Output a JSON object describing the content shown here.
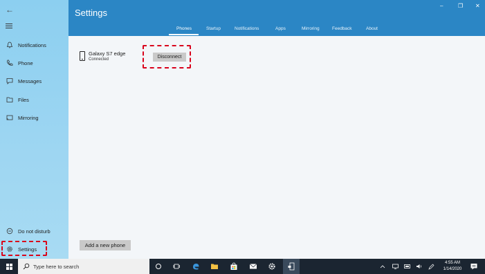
{
  "window": {
    "title": "Settings",
    "min_glyph": "–",
    "max_glyph": "❐",
    "close_glyph": "✕"
  },
  "tabs": [
    {
      "label": "Phones",
      "active": true
    },
    {
      "label": "Startup"
    },
    {
      "label": "Notifications"
    },
    {
      "label": "Apps"
    },
    {
      "label": "Mirroring"
    },
    {
      "label": "Feedback"
    },
    {
      "label": "About"
    }
  ],
  "sidebar": {
    "back_glyph": "←",
    "items": [
      {
        "label": "Notifications",
        "icon": "bell-icon"
      },
      {
        "label": "Phone",
        "icon": "phone-handset-icon"
      },
      {
        "label": "Messages",
        "icon": "message-icon"
      },
      {
        "label": "Files",
        "icon": "folder-icon"
      },
      {
        "label": "Mirroring",
        "icon": "cast-icon"
      }
    ],
    "bottom": [
      {
        "label": "Do not disturb",
        "icon": "do-not-disturb-icon"
      },
      {
        "label": "Settings",
        "icon": "gear-icon"
      }
    ]
  },
  "phone": {
    "name": "Galaxy S7 edge",
    "status": "Connected",
    "disconnect_label": "Disconnect"
  },
  "add_phone_label": "Add a new phone",
  "taskbar": {
    "search_placeholder": "Type here to search",
    "time": "4:55 AM",
    "date": "1/14/2020"
  },
  "colors": {
    "header": "#2b86c5",
    "sidebar": "#9ed6f2",
    "highlight": "#d9001b",
    "taskbar": "#1b2531"
  }
}
